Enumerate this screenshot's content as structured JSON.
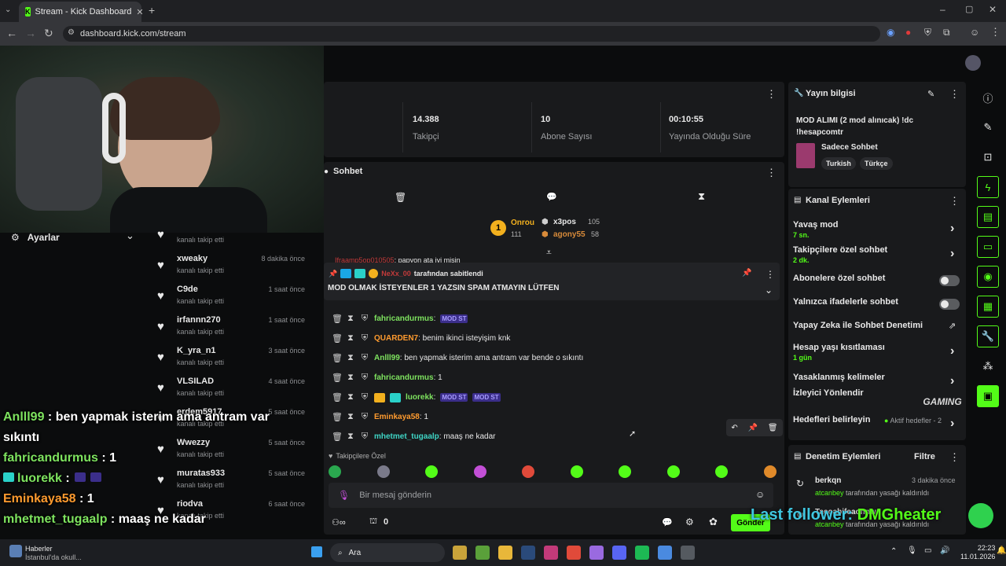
{
  "browser": {
    "tab_title": "Stream - Kick Dashboard",
    "url": "dashboard.kick.com/stream"
  },
  "stats": [
    {
      "value": "14.388",
      "label": "Takipçi"
    },
    {
      "value": "10",
      "label": "Abone Sayısı"
    },
    {
      "value": "00:10:55",
      "label": "Yayında Olduğu Süre"
    }
  ],
  "settings_label": "Ayarlar",
  "followers": [
    {
      "name": "",
      "sub": "kanalı takip etti",
      "time": ""
    },
    {
      "name": "xweaky",
      "sub": "kanalı takip etti",
      "time": "8 dakika önce"
    },
    {
      "name": "C9de",
      "sub": "kanalı takip etti",
      "time": "1 saat önce"
    },
    {
      "name": "irfannn270",
      "sub": "kanalı takip etti",
      "time": "1 saat önce"
    },
    {
      "name": "K_yra_n1",
      "sub": "kanalı takip etti",
      "time": "3 saat önce"
    },
    {
      "name": "VLSILAD",
      "sub": "kanalı takip etti",
      "time": "4 saat önce"
    },
    {
      "name": "erdem5917",
      "sub": "kanalı takip etti",
      "time": "5 saat önce"
    },
    {
      "name": "Wwezzy",
      "sub": "kanalı takip etti",
      "time": "5 saat önce"
    },
    {
      "name": "muratas933",
      "sub": "kanalı takip etti",
      "time": "5 saat önce"
    },
    {
      "name": "riodva",
      "sub": "kanalı takip etti",
      "time": "6 saat önce"
    }
  ],
  "chat": {
    "title": "Sohbet",
    "leaders": {
      "first": {
        "rank": "1",
        "name": "Onrou",
        "score": "111"
      },
      "second": {
        "name": "x3pos",
        "score": "105"
      },
      "third": {
        "name": "agony55",
        "score": "58"
      }
    },
    "partial_line": {
      "name": "Ifraamp5op010505",
      "text": ": papyon ata iyi misin"
    },
    "pinned": {
      "by": "NeXx_00",
      "by_suffix": "tarafından sabitlendi",
      "text": "MOD OLMAK İSTEYENLER 1 YAZSIN SPAM ATMAYIN LÜTFEN"
    },
    "messages": [
      {
        "name": "fahricandurmus",
        "text": "",
        "color": "#7ee35f",
        "emotes": [
          "MOD ST"
        ]
      },
      {
        "name": "QUARDEN7",
        "text": ": benim ikinci isteyişim knk",
        "color": "#ff9b2f",
        "emotes": []
      },
      {
        "name": "Anlll99",
        "text": ": ben yapmak isterim ama antram var bende o sıkıntı",
        "color": "#7ee35f",
        "emotes": []
      },
      {
        "name": "fahricandurmus",
        "text": ": 1",
        "color": "#7ee35f",
        "emotes": []
      },
      {
        "name": "luorekk",
        "text": "",
        "color": "#7ee35f",
        "emotes": [
          "MOD ST",
          "MOD ST"
        ]
      },
      {
        "name": "Eminkaya58",
        "text": ": 1",
        "color": "#ff9b2f",
        "emotes": []
      },
      {
        "name": "mhetmet_tugaalp",
        "text": ": maaş ne kadar",
        "color": "#3fd5c5",
        "emotes": []
      }
    ],
    "followers_only": "Takipçilere Özel",
    "input_placeholder": "Bir mesaj gönderin",
    "count": "0",
    "send": "Gönder"
  },
  "stream_info": {
    "title": "Yayın bilgisi",
    "stream_title": "MOD ALIMI (2 mod alınıcak) !dc !hesapcomtr",
    "category": "Sadece Sohbet",
    "tags": [
      "Turkish",
      "Türkçe"
    ]
  },
  "channel_actions": {
    "title": "Kanal Eylemleri",
    "items": [
      {
        "label": "Yavaş mod",
        "sub": "7 sn.",
        "kind": "chevron"
      },
      {
        "label": "Takipçilere özel sohbet",
        "sub": "2 dk.",
        "kind": "chevron"
      },
      {
        "label": "Abonelere özel sohbet",
        "sub": "",
        "kind": "toggle"
      },
      {
        "label": "Yalnızca ifadelerle sohbet",
        "sub": "",
        "kind": "toggle"
      },
      {
        "label": "Yapay Zeka ile Sohbet Denetimi",
        "sub": "",
        "kind": "external"
      },
      {
        "label": "Hesap yaşı kısıtlaması",
        "sub": "1 gün",
        "kind": "chevron"
      },
      {
        "label": "Yasaklanmış kelimeler",
        "sub": "",
        "kind": "chevron"
      },
      {
        "label": "İzleyici Yönlendir",
        "sub": "",
        "kind": "none"
      },
      {
        "label": "Hedefleri belirleyin",
        "sub": "",
        "kind": "chevron"
      }
    ],
    "goals_status": "Aktif hedefler - 2"
  },
  "moderation": {
    "title": "Denetim Eylemleri",
    "filter": "Filtre",
    "items": [
      {
        "name": "berkqn",
        "time": "3 dakika önce",
        "by": "atcanbey",
        "action": "tarafından yasağı kaldırıldı"
      },
      {
        "name": "Tacoabifeaonnw",
        "time": "",
        "by": "atcanbey",
        "action": "tarafından yasağı kaldırıldı"
      }
    ]
  },
  "overlay": {
    "lines": [
      {
        "name": "Anlll99",
        "text": " : ben yapmak isterim ama antram var",
        "color": "#7ee35f"
      },
      {
        "name": "",
        "text": "sıkıntı",
        "color": "#ffffff"
      },
      {
        "name": "fahricandurmus",
        "text": " : 1",
        "color": "#7ee35f"
      },
      {
        "name": "luorekk",
        "text": " :",
        "color": "#7ee35f"
      },
      {
        "name": "Eminkaya58",
        "text": " : 1",
        "color": "#ff9b2f"
      },
      {
        "name": "mhetmet_tugaalp",
        "text": " : maaş ne kadar",
        "color": "#7ee35f"
      }
    ],
    "last_follower_label": "Last follower:",
    "last_follower_name": "DMGheater",
    "gaming_logo": "GAMING"
  },
  "taskbar": {
    "news_title": "Haberler",
    "news_sub": "İstanbul'da okull...",
    "search": "Ara",
    "time": "22:23",
    "date": "11.01.2026"
  },
  "colors": {
    "accent": "#53fc18",
    "panel": "#191a1c",
    "page": "#0b0c0d"
  }
}
